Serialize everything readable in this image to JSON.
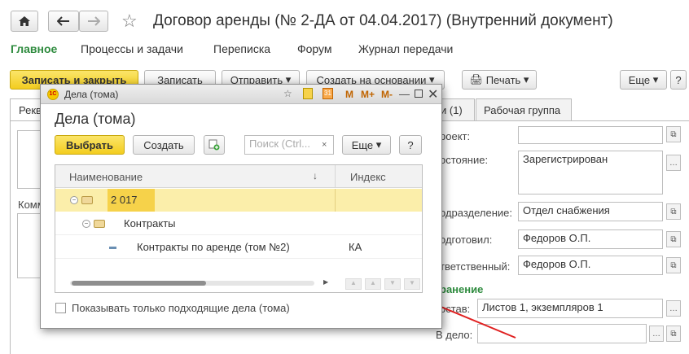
{
  "window": {
    "title": "Договор аренды (№ 2-ДА от 04.04.2017) (Внутренний документ)"
  },
  "menu": [
    "Главное",
    "Процессы и задачи",
    "Переписка",
    "Форум",
    "Журнал передачи"
  ],
  "toolbar": {
    "save_close": "Записать и закрыть",
    "save": "Записать",
    "send": "Отправить",
    "create_based": "Создать на основании",
    "print": "Печать",
    "more": "Еще"
  },
  "tabs": {
    "left_partial": "Рекв",
    "tab2": "и (1)",
    "tab3": "Рабочая группа"
  },
  "left": {
    "comment_label": "Комм"
  },
  "form": {
    "project_label": "роект:",
    "project_value": "",
    "state_label": "остояние:",
    "state_value": "Зарегистрирован",
    "dept_label": "одразделение:",
    "dept_value": "Отдел снабжения",
    "prepared_label": "одготовил:",
    "prepared_value": "Федоров О.П.",
    "resp_label": "тветственный:",
    "resp_value": "Федоров О.П.",
    "storage_header": "ранение",
    "composition_label": "остав:",
    "composition_value": "Листов 1, экземпляров 1",
    "case_label": "В дело:",
    "case_value": ""
  },
  "modal": {
    "title_bar": "Дела (тома)",
    "heading": "Дела (тома)",
    "select_btn": "Выбрать",
    "create_btn": "Создать",
    "search_placeholder": "Поиск (Ctrl...",
    "more_btn": "Еще",
    "help_btn": "?",
    "col_name": "Наименование",
    "col_index": "Индекс",
    "rows": [
      {
        "name": "2 017",
        "index": ""
      },
      {
        "name": "Контракты",
        "index": ""
      },
      {
        "name": "Контракты по аренде (том №2)",
        "index": "КА"
      }
    ],
    "checkbox_label": "Показывать только подходящие дела (тома)"
  },
  "colors": {
    "accent_green": "#2e8b3e",
    "highlight_yellow": "#fbeeaa",
    "select_yellow": "#f3cd1f",
    "arrow_red": "#e02020"
  }
}
